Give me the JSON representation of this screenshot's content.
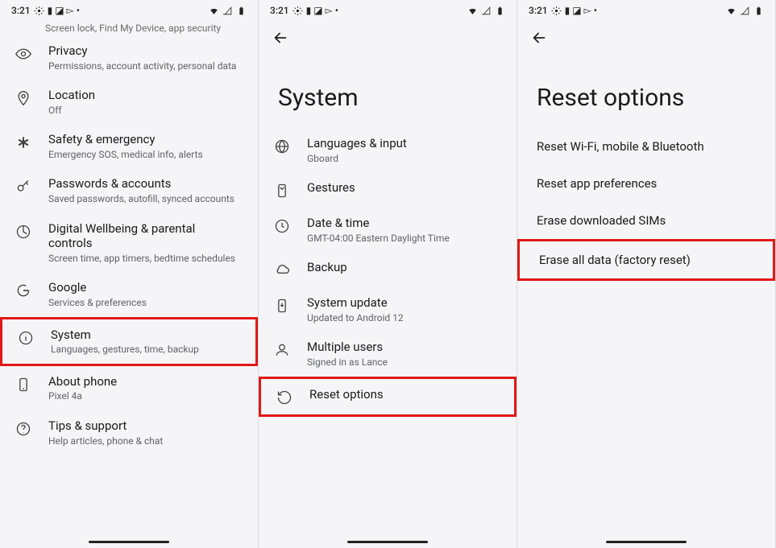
{
  "statusbar": {
    "time": "3:21"
  },
  "screen1": {
    "truncated": "Screen lock, Find My Device, app security",
    "items": [
      {
        "icon": "eye",
        "title": "Privacy",
        "sub": "Permissions, account activity, personal data"
      },
      {
        "icon": "pin",
        "title": "Location",
        "sub": "Off"
      },
      {
        "icon": "asterisk",
        "title": "Safety & emergency",
        "sub": "Emergency SOS, medical info, alerts"
      },
      {
        "icon": "key",
        "title": "Passwords & accounts",
        "sub": "Saved passwords, autofill, synced accounts"
      },
      {
        "icon": "wellbeing",
        "title": "Digital Wellbeing & parental controls",
        "sub": "Screen time, app timers, bedtime schedules"
      },
      {
        "icon": "google",
        "title": "Google",
        "sub": "Services & preferences"
      },
      {
        "icon": "info",
        "title": "System",
        "sub": "Languages, gestures, time, backup",
        "highlight": true
      },
      {
        "icon": "phone",
        "title": "About phone",
        "sub": "Pixel 4a"
      },
      {
        "icon": "help",
        "title": "Tips & support",
        "sub": "Help articles, phone & chat"
      }
    ]
  },
  "screen2": {
    "title": "System",
    "items": [
      {
        "icon": "globe",
        "title": "Languages & input",
        "sub": "Gboard"
      },
      {
        "icon": "gesture",
        "title": "Gestures"
      },
      {
        "icon": "clock",
        "title": "Date & time",
        "sub": "GMT-04:00 Eastern Daylight Time"
      },
      {
        "icon": "cloud",
        "title": "Backup"
      },
      {
        "icon": "update",
        "title": "System update",
        "sub": "Updated to Android 12"
      },
      {
        "icon": "users",
        "title": "Multiple users",
        "sub": "Signed in as Lance"
      },
      {
        "icon": "reset",
        "title": "Reset options",
        "highlight": true
      }
    ]
  },
  "screen3": {
    "title": "Reset options",
    "items": [
      {
        "title": "Reset Wi-Fi, mobile & Bluetooth"
      },
      {
        "title": "Reset app preferences"
      },
      {
        "title": "Erase downloaded SIMs"
      },
      {
        "title": "Erase all data (factory reset)",
        "highlight": true
      }
    ]
  }
}
